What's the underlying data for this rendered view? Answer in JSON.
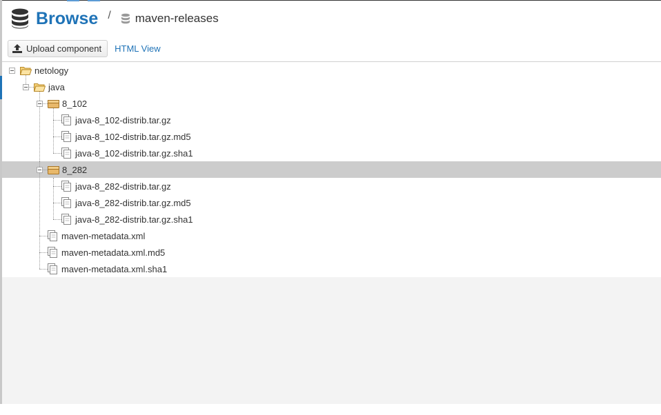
{
  "header": {
    "title": "Browse",
    "separator": "/",
    "repository": "maven-releases"
  },
  "toolbar": {
    "upload_label": "Upload component",
    "html_view_label": "HTML View"
  },
  "tree": {
    "nodes": [
      {
        "label": "netology",
        "type": "folder"
      },
      {
        "label": "java",
        "type": "folder"
      },
      {
        "label": "8_102",
        "type": "component"
      },
      {
        "label": "java-8_102-distrib.tar.gz",
        "type": "asset"
      },
      {
        "label": "java-8_102-distrib.tar.gz.md5",
        "type": "asset"
      },
      {
        "label": "java-8_102-distrib.tar.gz.sha1",
        "type": "asset"
      },
      {
        "label": "8_282",
        "type": "component",
        "selected": true
      },
      {
        "label": "java-8_282-distrib.tar.gz",
        "type": "asset"
      },
      {
        "label": "java-8_282-distrib.tar.gz.md5",
        "type": "asset"
      },
      {
        "label": "java-8_282-distrib.tar.gz.sha1",
        "type": "asset"
      },
      {
        "label": "maven-metadata.xml",
        "type": "asset"
      },
      {
        "label": "maven-metadata.xml.md5",
        "type": "asset"
      },
      {
        "label": "maven-metadata.xml.sha1",
        "type": "asset"
      }
    ]
  },
  "colors": {
    "accent": "#1f73b7",
    "selected_row": "#cccccc",
    "folder": "#f6d27a",
    "component": "#e8b86a"
  }
}
